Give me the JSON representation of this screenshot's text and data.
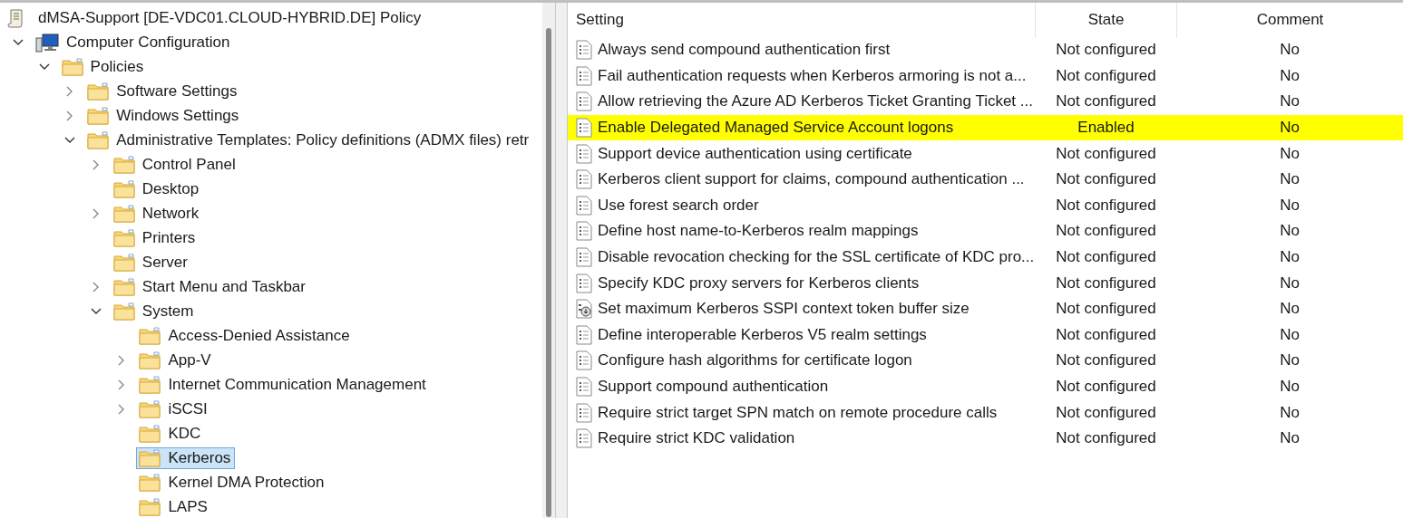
{
  "tree": {
    "title": "dMSA-Support [DE-VDC01.CLOUD-HYBRID.DE] Policy",
    "items": [
      {
        "label": "Computer Configuration",
        "kind": "computer",
        "expanded": true,
        "selected": false,
        "children": [
          {
            "label": "Policies",
            "kind": "folder",
            "expanded": true,
            "selected": false,
            "children": [
              {
                "label": "Software Settings",
                "kind": "folder",
                "expanded": false,
                "selected": false
              },
              {
                "label": "Windows Settings",
                "kind": "folder",
                "expanded": false,
                "selected": false
              },
              {
                "label": "Administrative Templates: Policy definitions (ADMX files) retr",
                "kind": "folder",
                "expanded": true,
                "selected": false,
                "children": [
                  {
                    "label": "Control Panel",
                    "kind": "folder",
                    "expanded": false,
                    "selected": false
                  },
                  {
                    "label": "Desktop",
                    "kind": "folder",
                    "selected": false
                  },
                  {
                    "label": "Network",
                    "kind": "folder",
                    "expanded": false,
                    "selected": false
                  },
                  {
                    "label": "Printers",
                    "kind": "folder",
                    "selected": false
                  },
                  {
                    "label": "Server",
                    "kind": "folder",
                    "selected": false
                  },
                  {
                    "label": "Start Menu and Taskbar",
                    "kind": "folder",
                    "expanded": false,
                    "selected": false
                  },
                  {
                    "label": "System",
                    "kind": "folder",
                    "expanded": true,
                    "selected": false,
                    "children": [
                      {
                        "label": "Access-Denied Assistance",
                        "kind": "folder",
                        "selected": false
                      },
                      {
                        "label": "App-V",
                        "kind": "folder",
                        "expanded": false,
                        "selected": false
                      },
                      {
                        "label": "Internet Communication Management",
                        "kind": "folder",
                        "expanded": false,
                        "selected": false
                      },
                      {
                        "label": "iSCSI",
                        "kind": "folder",
                        "expanded": false,
                        "selected": false
                      },
                      {
                        "label": "KDC",
                        "kind": "folder",
                        "selected": false
                      },
                      {
                        "label": "Kerberos",
                        "kind": "folder",
                        "selected": true
                      },
                      {
                        "label": "Kernel DMA Protection",
                        "kind": "folder",
                        "selected": false
                      },
                      {
                        "label": "LAPS",
                        "kind": "folder",
                        "selected": false
                      }
                    ]
                  }
                ]
              }
            ]
          }
        ]
      }
    ]
  },
  "table": {
    "columns": [
      "Setting",
      "State",
      "Comment"
    ],
    "rows": [
      {
        "setting": "Always send compound authentication first",
        "state": "Not configured",
        "comment": "No",
        "kind": "policy",
        "highlighted": false
      },
      {
        "setting": "Fail authentication requests when Kerberos armoring is not a...",
        "state": "Not configured",
        "comment": "No",
        "kind": "policy",
        "highlighted": false
      },
      {
        "setting": "Allow retrieving the Azure AD Kerberos Ticket Granting Ticket ...",
        "state": "Not configured",
        "comment": "No",
        "kind": "policy",
        "highlighted": false
      },
      {
        "setting": "Enable Delegated Managed Service Account logons",
        "state": "Enabled",
        "comment": "No",
        "kind": "policy",
        "highlighted": true
      },
      {
        "setting": "Support device authentication using certificate",
        "state": "Not configured",
        "comment": "No",
        "kind": "policy",
        "highlighted": false
      },
      {
        "setting": "Kerberos client support for claims, compound authentication ...",
        "state": "Not configured",
        "comment": "No",
        "kind": "policy",
        "highlighted": false
      },
      {
        "setting": "Use forest search order",
        "state": "Not configured",
        "comment": "No",
        "kind": "policy",
        "highlighted": false
      },
      {
        "setting": "Define host name-to-Kerberos realm mappings",
        "state": "Not configured",
        "comment": "No",
        "kind": "policy",
        "highlighted": false
      },
      {
        "setting": "Disable revocation checking for the SSL certificate of KDC pro...",
        "state": "Not configured",
        "comment": "No",
        "kind": "policy",
        "highlighted": false
      },
      {
        "setting": "Specify KDC proxy servers for Kerberos clients",
        "state": "Not configured",
        "comment": "No",
        "kind": "policy",
        "highlighted": false
      },
      {
        "setting": "Set maximum Kerberos SSPI context token buffer size",
        "state": "Not configured",
        "comment": "No",
        "kind": "download",
        "highlighted": false
      },
      {
        "setting": "Define interoperable Kerberos V5 realm settings",
        "state": "Not configured",
        "comment": "No",
        "kind": "policy",
        "highlighted": false
      },
      {
        "setting": "Configure hash algorithms for certificate logon",
        "state": "Not configured",
        "comment": "No",
        "kind": "policy",
        "highlighted": false
      },
      {
        "setting": "Support compound authentication",
        "state": "Not configured",
        "comment": "No",
        "kind": "policy",
        "highlighted": false
      },
      {
        "setting": "Require strict target SPN match on remote procedure calls",
        "state": "Not configured",
        "comment": "No",
        "kind": "policy",
        "highlighted": false
      },
      {
        "setting": "Require strict KDC validation",
        "state": "Not configured",
        "comment": "No",
        "kind": "policy",
        "highlighted": false
      }
    ]
  }
}
